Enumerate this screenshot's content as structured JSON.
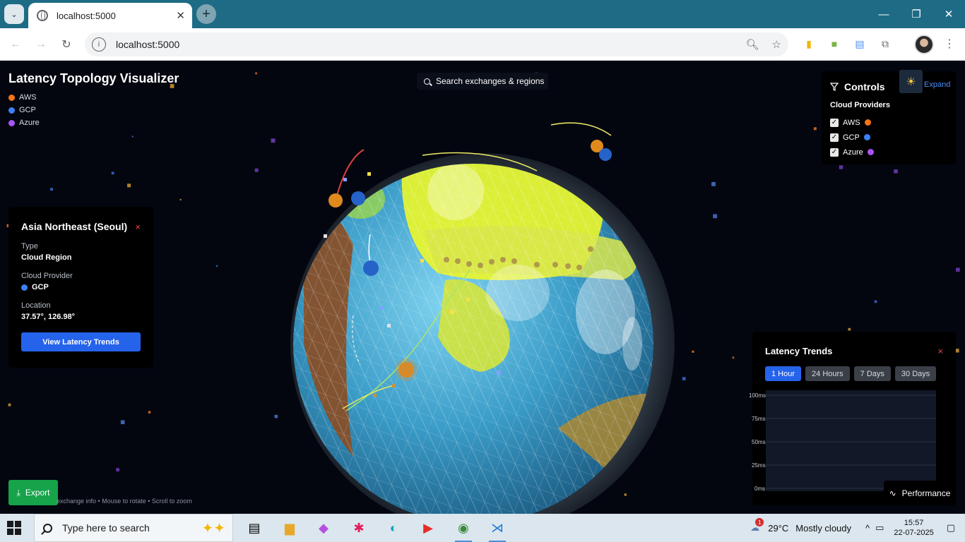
{
  "browser": {
    "tab_title": "localhost:5000",
    "url": "localhost:5000"
  },
  "app": {
    "title": "Latency Topology Visualizer",
    "legend": [
      {
        "label": "AWS",
        "color": "#f97316"
      },
      {
        "label": "GCP",
        "color": "#3b82f6"
      },
      {
        "label": "Azure",
        "color": "#a855f7"
      }
    ],
    "search_label": "Search exchanges & regions"
  },
  "controls": {
    "title": "Controls",
    "section": "Cloud Providers",
    "providers": [
      {
        "label": "AWS",
        "checked": true,
        "color": "#f97316"
      },
      {
        "label": "GCP",
        "checked": true,
        "color": "#3b82f6"
      },
      {
        "label": "Azure",
        "checked": true,
        "color": "#a855f7"
      }
    ],
    "expand_label": "Expand",
    "theme_icon": "sun-icon"
  },
  "region_info": {
    "name": "Asia Northeast (Seoul)",
    "close": "×",
    "type_label": "Type",
    "type_value": "Cloud Region",
    "provider_label": "Cloud Provider",
    "provider_value": "GCP",
    "provider_color": "#3b82f6",
    "location_label": "Location",
    "location_value": "37.57°, 126.98°",
    "button_label": "View Latency Trends"
  },
  "latency_trends": {
    "title": "Latency Trends",
    "close": "×",
    "ranges": [
      "1 Hour",
      "24 Hours",
      "7 Days",
      "30 Days"
    ],
    "active_range": "1 Hour",
    "y_ticks": [
      "100ms",
      "75ms",
      "50ms",
      "25ms",
      "0ms"
    ]
  },
  "performance_label": "Performance",
  "export_label": "Export",
  "hint": "exchange info • Mouse to rotate • Scroll to zoom",
  "taskbar": {
    "search_placeholder": "Type here to search",
    "weather_temp": "29°C",
    "weather_text": "Mostly cloudy",
    "weather_badge": "1",
    "time": "15:57",
    "date": "22-07-2025"
  }
}
